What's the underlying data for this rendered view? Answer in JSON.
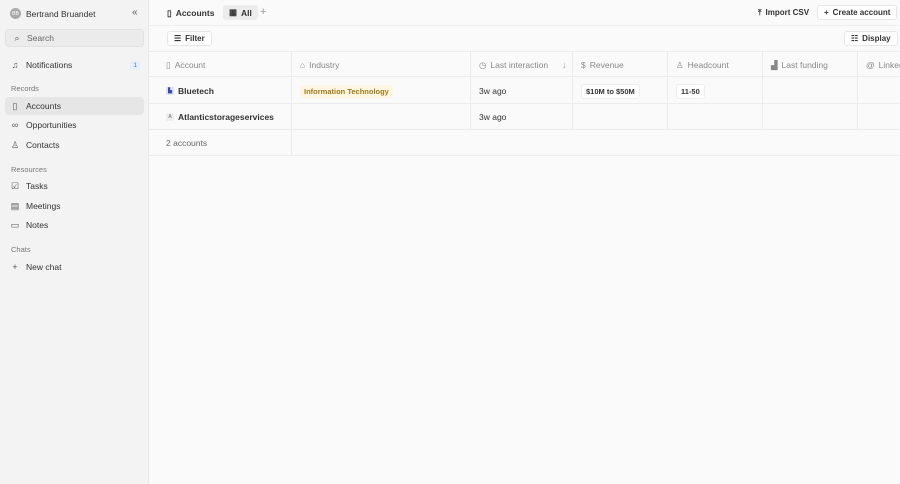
{
  "sidebar": {
    "user": "Bertrand Bruandet",
    "avatar_initials": "BB",
    "search": "Search",
    "notifications": {
      "label": "Notifications",
      "count": "1"
    },
    "records_title": "Records",
    "records": [
      "Accounts",
      "Opportunities",
      "Contacts"
    ],
    "resources_title": "Resources",
    "resources": [
      "Tasks",
      "Meetings",
      "Notes"
    ],
    "chats_title": "Chats",
    "new_chat": "New chat"
  },
  "topbar": {
    "object": "Accounts",
    "view": "All",
    "import": "Import CSV",
    "create": "Create account"
  },
  "toolbar": {
    "filter": "Filter",
    "display": "Display"
  },
  "table": {
    "columns": [
      "Account",
      "Industry",
      "Last interaction",
      "Revenue",
      "Headcount",
      "Last funding",
      "Linkedin"
    ],
    "rows": [
      {
        "account": "Bluetech",
        "logo": "",
        "industry": "Information Technology",
        "last_interaction": "3w ago",
        "revenue": "$10M to $50M",
        "headcount": "11-50"
      },
      {
        "account": "Atlanticstorageservices",
        "logo": "A",
        "industry": "",
        "last_interaction": "3w ago",
        "revenue": "",
        "headcount": ""
      }
    ],
    "footer": "2 accounts"
  },
  "colors": {
    "industry_chip_bg": "#fdf6e3",
    "industry_chip_text": "#a07a1c",
    "badge": "#5a7cb5"
  }
}
